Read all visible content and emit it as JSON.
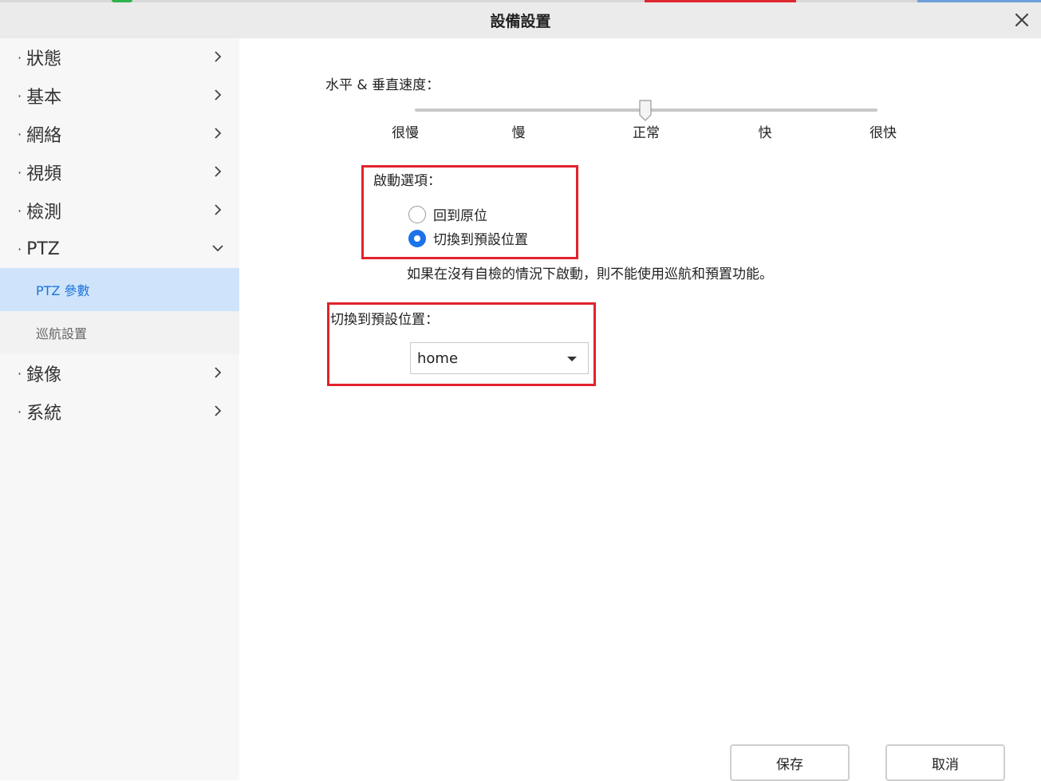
{
  "dialog": {
    "title": "設備設置"
  },
  "sidebar": {
    "items": [
      {
        "label": "狀態"
      },
      {
        "label": "基本"
      },
      {
        "label": "網絡"
      },
      {
        "label": "視頻"
      },
      {
        "label": "檢測"
      },
      {
        "label": "PTZ"
      },
      {
        "label": "錄像"
      },
      {
        "label": "系統"
      }
    ],
    "ptz_sub": [
      {
        "label": "PTZ 參數"
      },
      {
        "label": "巡航設置"
      }
    ]
  },
  "speed": {
    "label": "水平 & 垂直速度：",
    "ticks": [
      "很慢",
      "慢",
      "正常",
      "快",
      "很快"
    ],
    "selected": "正常"
  },
  "startup": {
    "label": "啟動選項：",
    "options": [
      "回到原位",
      "切換到預設位置"
    ],
    "selected": "切換到預設位置",
    "note": "如果在沒有自檢的情況下啟動，則不能使用巡航和預置功能。"
  },
  "preset": {
    "label": "切換到預設位置：",
    "value": "home"
  },
  "buttons": {
    "save": "保存",
    "cancel": "取消"
  },
  "colors": {
    "accent": "#1a73e8",
    "highlight_box": "#e1222c",
    "active_sub_bg": "#cfe4fb"
  }
}
